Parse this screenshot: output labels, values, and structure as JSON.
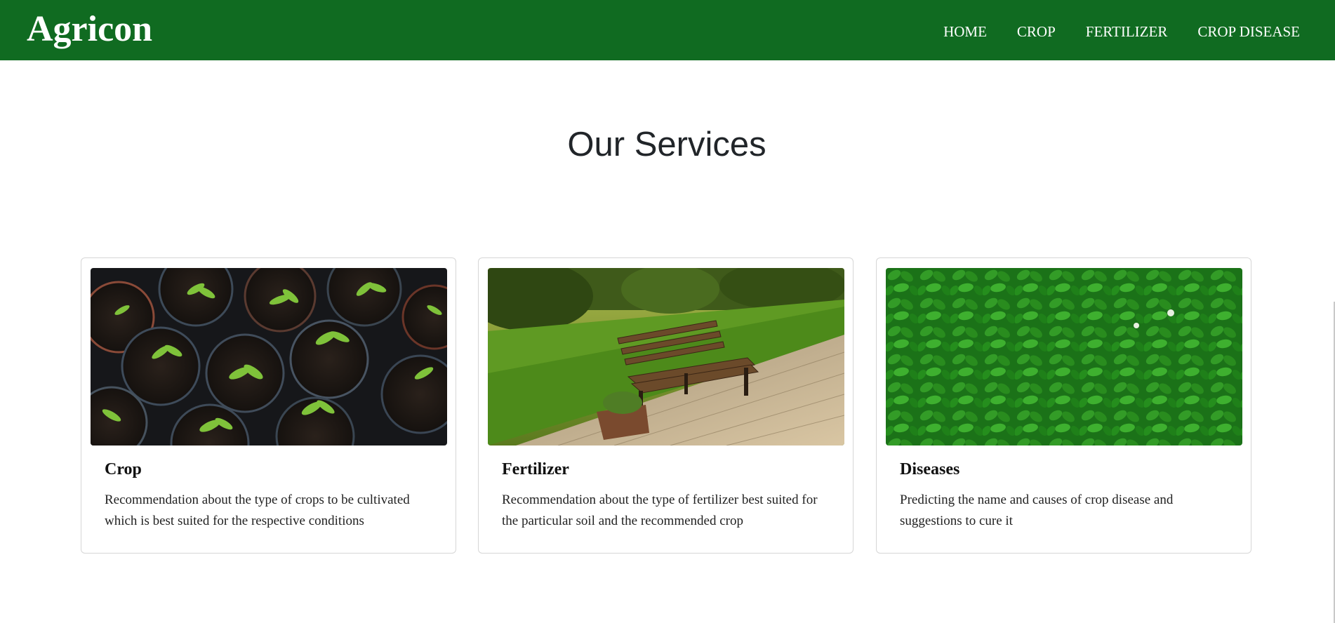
{
  "navbar": {
    "brand": "Agricon",
    "links": [
      "HOME",
      "CROP",
      "FERTILIZER",
      "CROP DISEASE"
    ]
  },
  "colors": {
    "navbar_bg": "#106b21",
    "nav_text": "#ffffff",
    "heading_text": "#212529"
  },
  "services": {
    "title": "Our Services",
    "cards": [
      {
        "title": "Crop",
        "text": "Recommendation about the type of crops to be cultivated which is best suited for the respective conditions",
        "image": "seedlings-in-pots-photo"
      },
      {
        "title": "Fertilizer",
        "text": "Recommendation about the type of fertilizer best suited for the particular soil and the recommended crop",
        "image": "garden-bench-photo"
      },
      {
        "title": "Diseases",
        "text": "Predicting the name and causes of crop disease and suggestions to cure it",
        "image": "green-leaves-photo"
      }
    ]
  }
}
